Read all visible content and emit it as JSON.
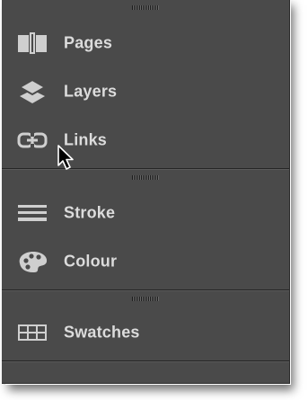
{
  "panel": {
    "sections": [
      {
        "items": [
          {
            "label": "Pages",
            "icon": "pages-icon"
          },
          {
            "label": "Layers",
            "icon": "layers-icon"
          },
          {
            "label": "Links",
            "icon": "links-icon"
          }
        ]
      },
      {
        "items": [
          {
            "label": "Stroke",
            "icon": "stroke-icon"
          },
          {
            "label": "Colour",
            "icon": "colour-palette-icon"
          }
        ]
      },
      {
        "items": [
          {
            "label": "Swatches",
            "icon": "swatches-grid-icon"
          }
        ]
      }
    ]
  },
  "colors": {
    "panel_background": "#4a4a4a",
    "label_text": "#dcdcdc",
    "icon": "#cfcfcf",
    "divider": "#262626"
  },
  "cursor": {
    "icon": "arrow-cursor-icon",
    "hovering": "Links"
  }
}
